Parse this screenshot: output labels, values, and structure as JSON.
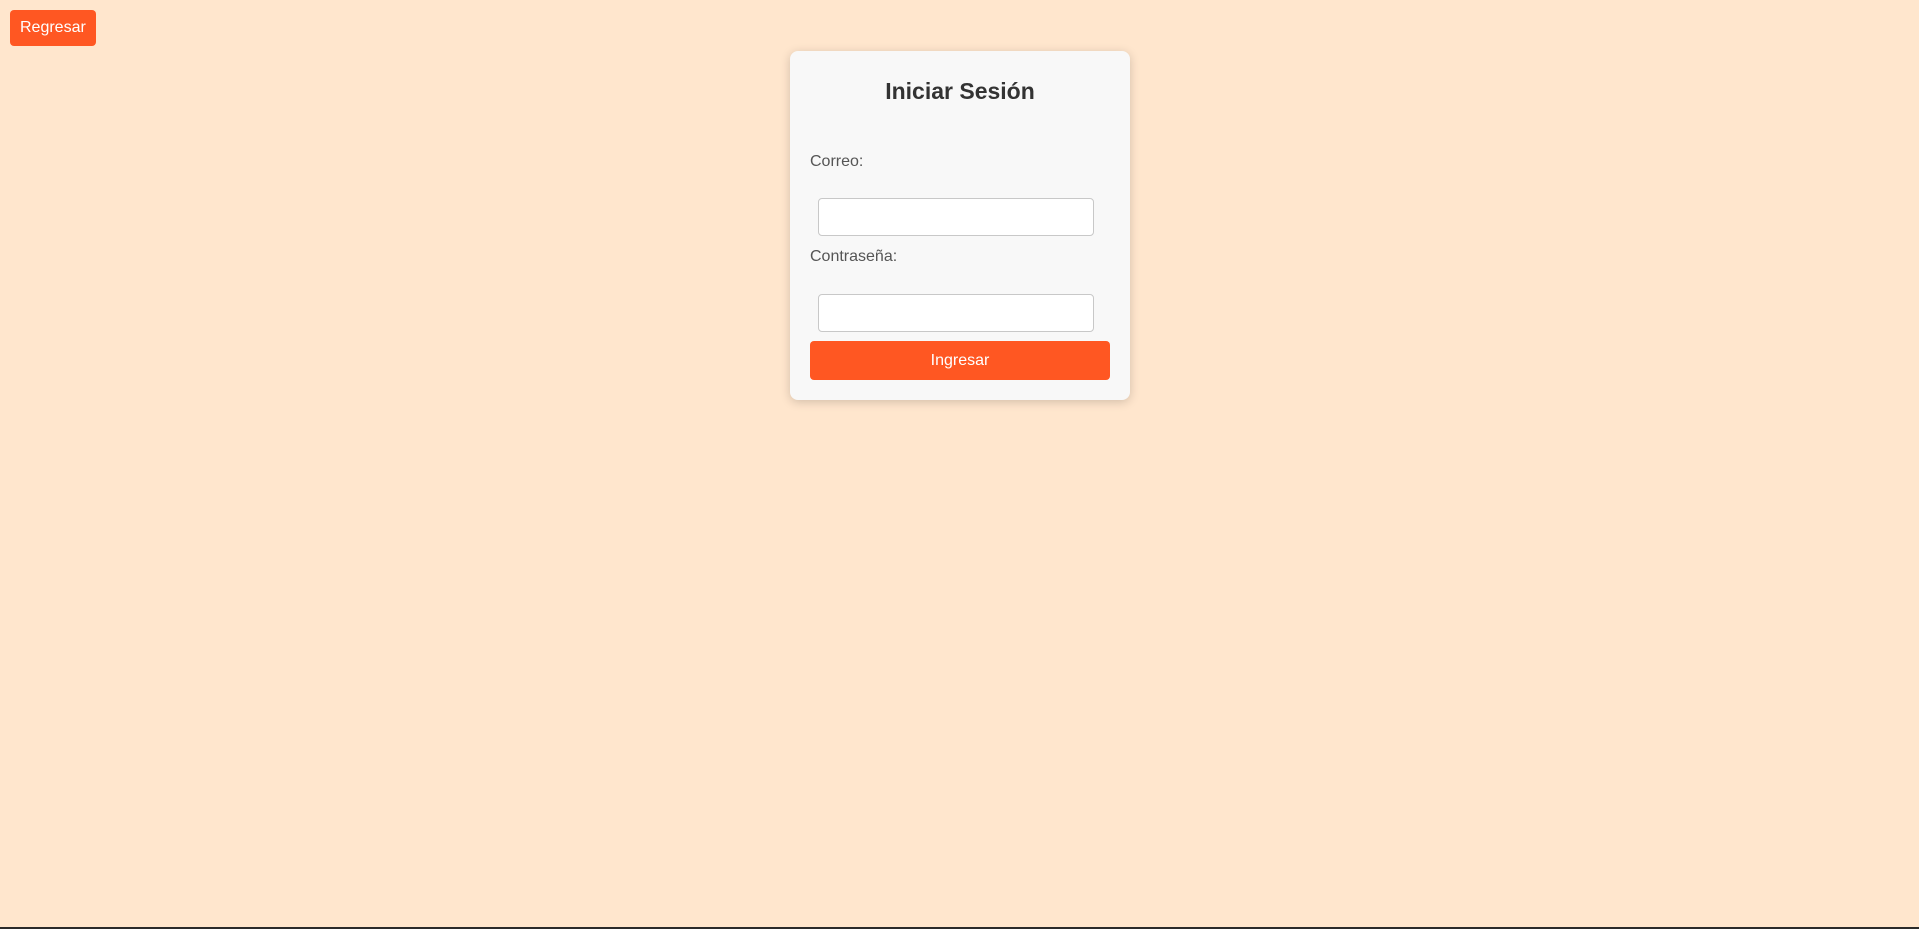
{
  "header": {
    "back_label": "Regresar"
  },
  "login": {
    "title": "Iniciar Sesión",
    "email_label": "Correo:",
    "email_value": "",
    "password_label": "Contraseña:",
    "password_value": "",
    "submit_label": "Ingresar"
  },
  "colors": {
    "background": "#ffe6cd",
    "accent": "#ff5722",
    "card": "#f8f8f8"
  }
}
